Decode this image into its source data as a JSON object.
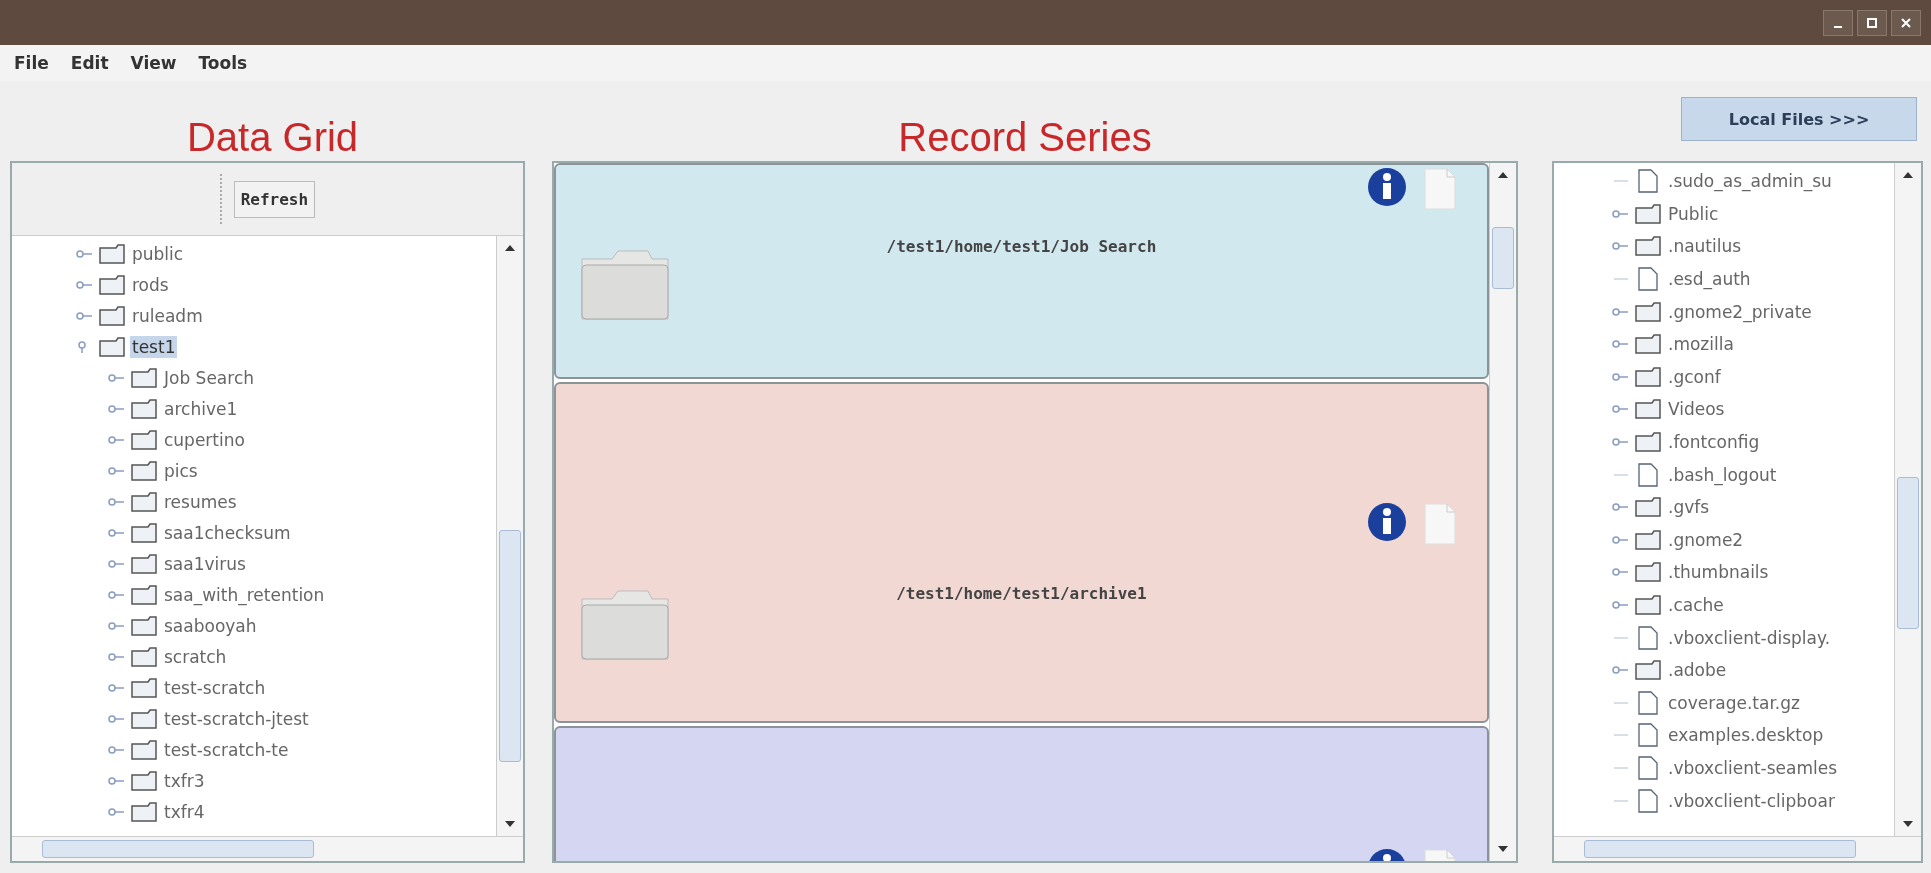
{
  "menu": [
    "File",
    "Edit",
    "View",
    "Tools"
  ],
  "headings": {
    "left": "Data Grid",
    "center": "Record Series"
  },
  "local_files_button": "Local Files >>>",
  "data_grid": {
    "refresh_button": "Refresh",
    "tree": [
      {
        "name": "public",
        "expanded": false,
        "selected": false
      },
      {
        "name": "rods",
        "expanded": false,
        "selected": false
      },
      {
        "name": "ruleadm",
        "expanded": false,
        "selected": false
      },
      {
        "name": "test1",
        "expanded": true,
        "selected": true,
        "children": [
          {
            "name": "Job Search",
            "expanded": false,
            "selected": false
          },
          {
            "name": "archive1",
            "expanded": false,
            "selected": false
          },
          {
            "name": "cupertino",
            "expanded": false,
            "selected": false
          },
          {
            "name": "pics",
            "expanded": false,
            "selected": false
          },
          {
            "name": "resumes",
            "expanded": false,
            "selected": false
          },
          {
            "name": "saa1checksum",
            "expanded": false,
            "selected": false
          },
          {
            "name": "saa1virus",
            "expanded": false,
            "selected": false
          },
          {
            "name": "saa_with_retention",
            "expanded": false,
            "selected": false
          },
          {
            "name": "saabooyah",
            "expanded": false,
            "selected": false
          },
          {
            "name": "scratch",
            "expanded": false,
            "selected": false
          },
          {
            "name": "test-scratch",
            "expanded": false,
            "selected": false
          },
          {
            "name": "test-scratch-jtest",
            "expanded": false,
            "selected": false
          },
          {
            "name": "test-scratch-te",
            "expanded": false,
            "selected": false
          },
          {
            "name": "txfr3",
            "expanded": false,
            "selected": false
          },
          {
            "name": "txfr4",
            "expanded": false,
            "selected": false
          }
        ]
      }
    ]
  },
  "record_series": [
    {
      "path": "/test1/home/test1/Job Search",
      "color": "#d2e8ef"
    },
    {
      "path": "/test1/home/test1/archive1",
      "color": "#f1d8d3"
    },
    {
      "color": "#d4d6f2"
    }
  ],
  "local_files": [
    {
      "name": ".sudo_as_admin_su",
      "kind": "file"
    },
    {
      "name": "Public",
      "kind": "folder"
    },
    {
      "name": ".nautilus",
      "kind": "folder"
    },
    {
      "name": ".esd_auth",
      "kind": "file"
    },
    {
      "name": ".gnome2_private",
      "kind": "folder"
    },
    {
      "name": ".mozilla",
      "kind": "folder"
    },
    {
      "name": ".gconf",
      "kind": "folder"
    },
    {
      "name": "Videos",
      "kind": "folder"
    },
    {
      "name": ".fontconfig",
      "kind": "folder"
    },
    {
      "name": ".bash_logout",
      "kind": "file"
    },
    {
      "name": ".gvfs",
      "kind": "folder"
    },
    {
      "name": ".gnome2",
      "kind": "folder"
    },
    {
      "name": ".thumbnails",
      "kind": "folder"
    },
    {
      "name": ".cache",
      "kind": "folder"
    },
    {
      "name": ".vboxclient-display.",
      "kind": "file"
    },
    {
      "name": ".adobe",
      "kind": "folder"
    },
    {
      "name": "coverage.tar.gz",
      "kind": "file"
    },
    {
      "name": "examples.desktop",
      "kind": "file"
    },
    {
      "name": ".vboxclient-seamles",
      "kind": "file"
    },
    {
      "name": ".vboxclient-clipboar",
      "kind": "file"
    }
  ]
}
